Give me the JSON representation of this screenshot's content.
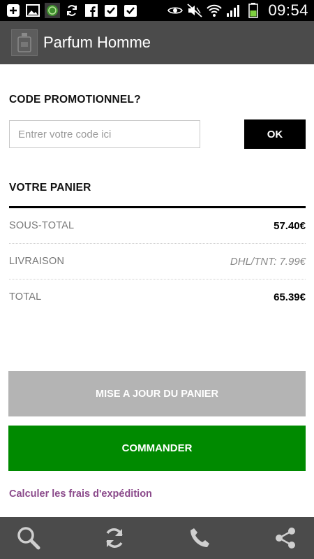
{
  "status_bar": {
    "time": "09:54",
    "left_icons": [
      "add-icon",
      "image-icon",
      "app-notification-icon",
      "sync-icon",
      "facebook-icon",
      "task-check-icon",
      "task-check-icon"
    ],
    "right_icons": [
      "eye-icon",
      "mute-icon",
      "wifi-icon",
      "signal-icon",
      "battery-icon"
    ]
  },
  "app_bar": {
    "title": "Parfum Homme",
    "logo_icon": "perfume-logo-icon"
  },
  "promo": {
    "title": "CODE PROMOTIONNEL?",
    "placeholder": "Entrer votre code ici",
    "value": "",
    "button_label": "OK"
  },
  "cart": {
    "title": "VOTRE PANIER",
    "rows": [
      {
        "label": "SOUS-TOTAL",
        "value": "57.40€"
      },
      {
        "label": "LIVRAISON",
        "value": "DHL/TNT: 7.99€"
      },
      {
        "label": "TOTAL",
        "value": "65.39€"
      }
    ]
  },
  "actions": {
    "update_label": "MISE A JOUR DU PANIER",
    "order_label": "COMMANDER",
    "shipping_link": "Calculer les frais d'expédition"
  },
  "bottom_bar": {
    "icons": [
      "search-icon",
      "refresh-icon",
      "phone-icon",
      "share-icon"
    ]
  },
  "colors": {
    "app_bar": "#4b4b4b",
    "order_button": "#008a00",
    "update_button": "#b4b4b4",
    "link": "#8b4a8b"
  }
}
